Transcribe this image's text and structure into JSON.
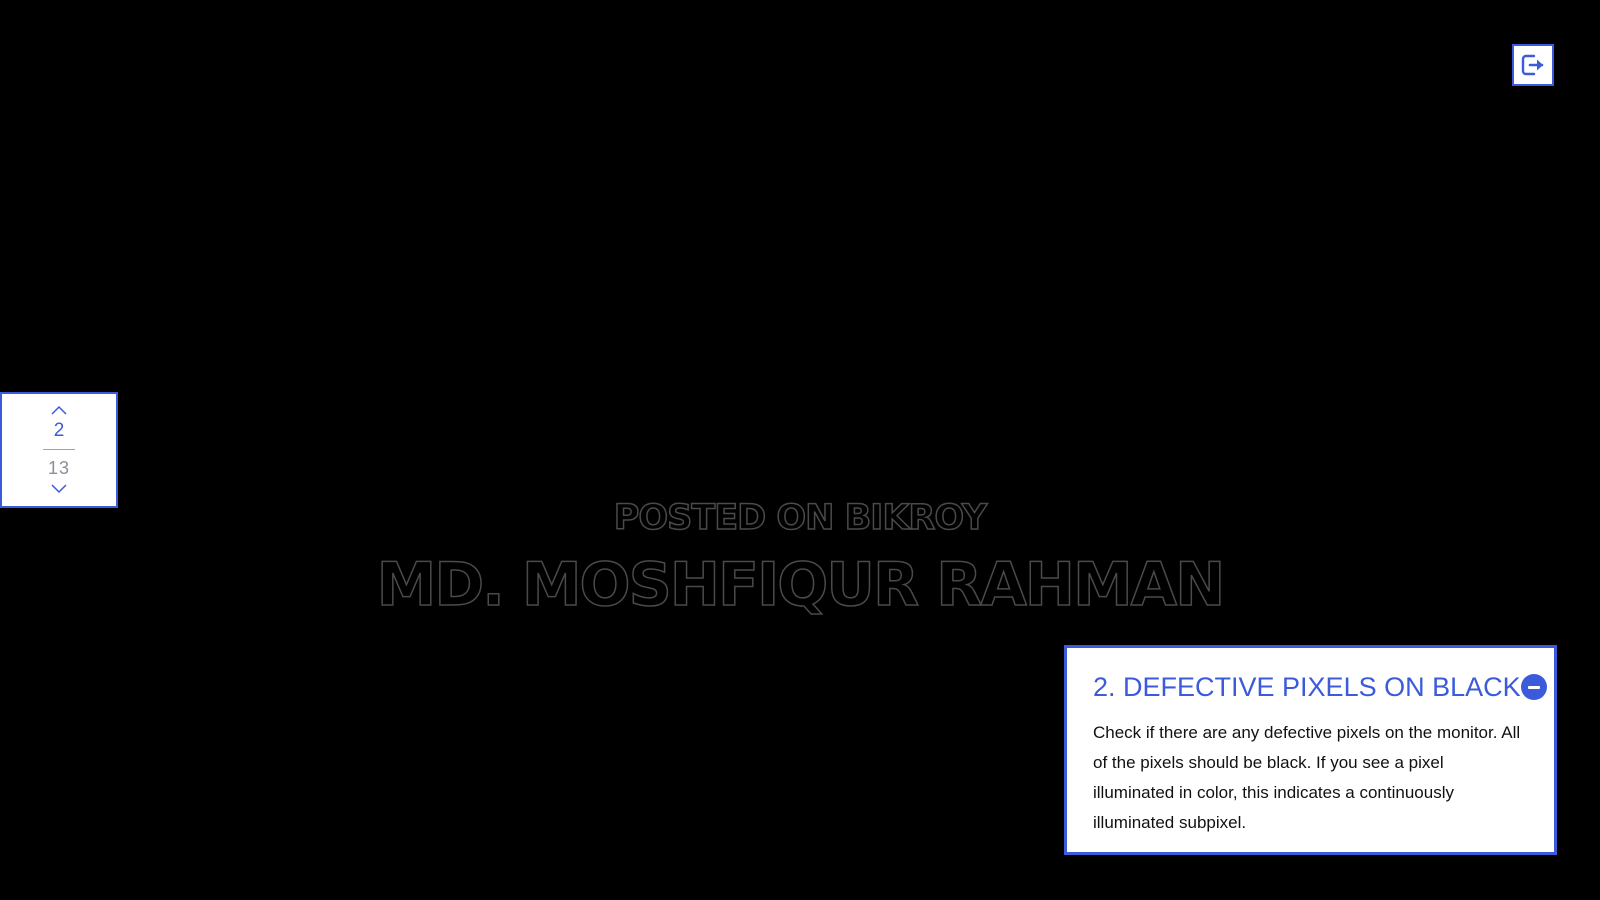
{
  "exit_button": {
    "icon": "exit-icon"
  },
  "pager": {
    "current": "2",
    "total": "13",
    "up_icon": "chevron-up-icon",
    "down_icon": "chevron-down-icon"
  },
  "watermark": {
    "line1": "POSTED ON BIKROY",
    "line2": "MD. MOSHFIQUR RAHMAN"
  },
  "info_card": {
    "title": "2. DEFECTIVE PIXELS ON BLACK",
    "description": "Check if there are any defective pixels on the monitor. All of the pixels should be black. If you see a pixel illuminated in color, this indicates a continuously illuminated subpixel.",
    "collapse_icon": "minus-circle-icon"
  },
  "colors": {
    "accent": "#3b5bdb",
    "background": "#000000",
    "card_background": "#ffffff",
    "watermark_outline": "#4a4a4a"
  }
}
